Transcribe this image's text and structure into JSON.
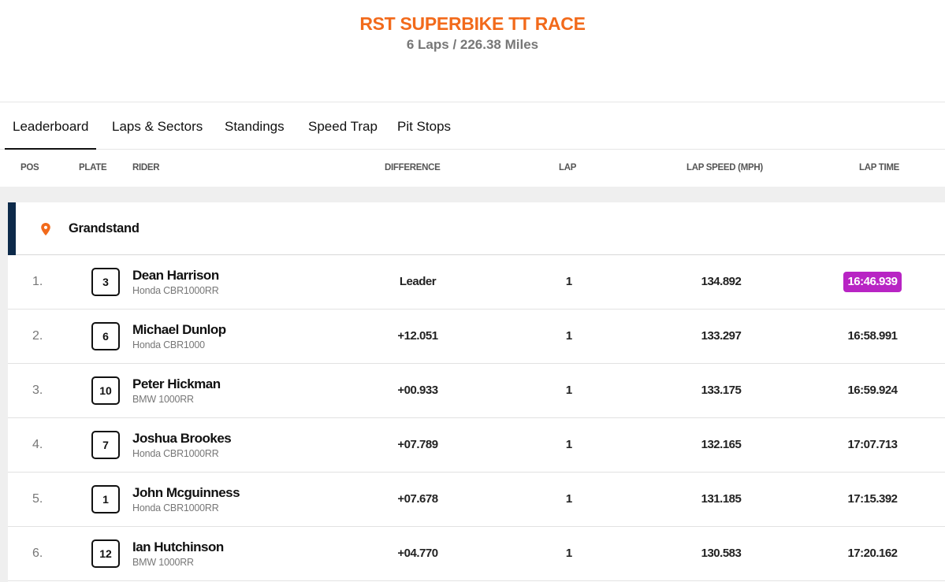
{
  "race": {
    "title": "RST SUPERBIKE TT RACE",
    "subtitle": "6 Laps / 226.38 Miles"
  },
  "tabs": [
    {
      "label": "Leaderboard",
      "active": true
    },
    {
      "label": "Laps & Sectors",
      "active": false
    },
    {
      "label": "Standings",
      "active": false
    },
    {
      "label": "Speed Trap",
      "active": false
    },
    {
      "label": "Pit Stops",
      "active": false
    }
  ],
  "columns": {
    "pos": "POS",
    "plate": "PLATE",
    "rider": "RIDER",
    "difference": "DIFFERENCE",
    "lap": "LAP",
    "lap_speed": "LAP SPEED (MPH)",
    "lap_time": "LAP TIME"
  },
  "section": {
    "icon": "location-pin-icon",
    "label": "Grandstand",
    "bar_color": "#0d2a4a",
    "icon_color": "#f26a1b"
  },
  "colors": {
    "accent": "#f26a1b",
    "fastest_lap": "#b824c4"
  },
  "rows": [
    {
      "pos": "1.",
      "plate": "3",
      "name": "Dean Harrison",
      "bike": "Honda CBR1000RR",
      "difference": "Leader",
      "lap": "1",
      "speed": "134.892",
      "time": "16:46.939",
      "fastest": true
    },
    {
      "pos": "2.",
      "plate": "6",
      "name": "Michael Dunlop",
      "bike": "Honda CBR1000",
      "difference": "+12.051",
      "lap": "1",
      "speed": "133.297",
      "time": "16:58.991",
      "fastest": false
    },
    {
      "pos": "3.",
      "plate": "10",
      "name": "Peter Hickman",
      "bike": "BMW 1000RR",
      "difference": "+00.933",
      "lap": "1",
      "speed": "133.175",
      "time": "16:59.924",
      "fastest": false
    },
    {
      "pos": "4.",
      "plate": "7",
      "name": "Joshua Brookes",
      "bike": "Honda CBR1000RR",
      "difference": "+07.789",
      "lap": "1",
      "speed": "132.165",
      "time": "17:07.713",
      "fastest": false
    },
    {
      "pos": "5.",
      "plate": "1",
      "name": "John Mcguinness",
      "bike": "Honda CBR1000RR",
      "difference": "+07.678",
      "lap": "1",
      "speed": "131.185",
      "time": "17:15.392",
      "fastest": false
    },
    {
      "pos": "6.",
      "plate": "12",
      "name": "Ian Hutchinson",
      "bike": "BMW 1000RR",
      "difference": "+04.770",
      "lap": "1",
      "speed": "130.583",
      "time": "17:20.162",
      "fastest": false
    }
  ]
}
